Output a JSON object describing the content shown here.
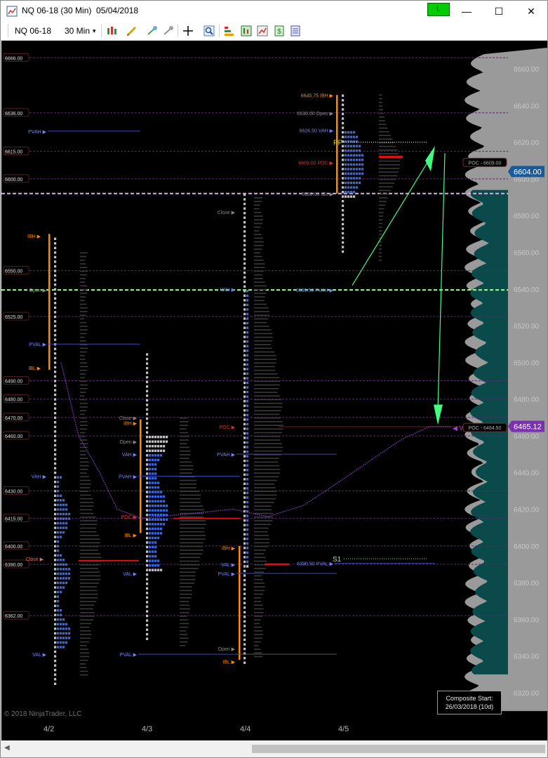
{
  "window": {
    "title": "NQ 06-18 (30 Min)  05/04/2018",
    "status_badge": "L",
    "minimize_glyph": "—",
    "maximize_glyph": "☐",
    "close_glyph": "✕"
  },
  "toolbar": {
    "instrument": "NQ 06-18",
    "interval": "30 Min",
    "dropdown_glyph": "▾",
    "icons": [
      "bar-type-icon",
      "drawing-tool-icon",
      "indicators-icon",
      "strategies-icon",
      "crosshair-icon",
      "zoom-icon",
      "chart-trader-icon",
      "data-box-icon",
      "chart-style-icon",
      "properties-icon",
      "templates-icon"
    ]
  },
  "price_axis": {
    "ticks": [
      "6660.00",
      "6640.00",
      "6620.00",
      "6600.00",
      "6580.00",
      "6560.00",
      "6540.00",
      "6520.00",
      "6500.00",
      "6480.00",
      "6460.00",
      "6440.00",
      "6420.00",
      "6400.00",
      "6380.00",
      "6360.00",
      "6340.00",
      "6320.00"
    ],
    "current_price": "6604.00",
    "composite_poc_label": "POC - 6609.00",
    "vwap_price": "6465.12",
    "vwap_poc_label": "POC - 6464.50"
  },
  "left_price_labels": [
    "6666.00",
    "6636.00",
    "6615.00",
    "6600.00",
    "6550.00",
    "6525.00",
    "6490.00",
    "6480.00",
    "6470.00",
    "6460.00",
    "6430.00",
    "6415.00",
    "6400.00",
    "6390.00",
    "6362.00"
  ],
  "sessions": [
    {
      "date": "4/2",
      "labels": [
        "IBH",
        "Open",
        "PVAH",
        "PVAL",
        "IBL",
        "VAH",
        "Close",
        "VAL"
      ]
    },
    {
      "date": "4/3",
      "labels": [
        "Close",
        "IBH",
        "Open",
        "VAH",
        "PVAH",
        "POC",
        "IBL",
        "VAL",
        "PVAL"
      ]
    },
    {
      "date": "4/4",
      "labels": [
        "Close",
        "VAH",
        "POC",
        "PVAH",
        "IBH",
        "VAL",
        "PVAL",
        "Open",
        "IBL"
      ]
    },
    {
      "date": "4/5",
      "labels": [
        "6645.75 IBH",
        "6636.00 Open",
        "6626.50 VAH",
        "6609.00 POC",
        "6592.00 IBL",
        "6539.50 PVAH",
        "6390.50 PVAL"
      ]
    }
  ],
  "pivots": {
    "pp": "PP",
    "s1": "S1",
    "vwap_marker": "V"
  },
  "x_axis": {
    "dates": [
      "4/2",
      "4/3",
      "4/4",
      "4/5"
    ]
  },
  "composite_box": {
    "line1": "Composite Start:",
    "line2": "26/03/2018 (10d)"
  },
  "copyright": "© 2018 NinjaTrader, LLC",
  "colors": {
    "profile_value_area": "#3a68d8",
    "profile_tpo": "#c0c0c0",
    "ib_bar": "#ff8c00",
    "poc": "#e01010",
    "vwap": "#a040e0",
    "pivot_line": "#90ee90",
    "arrow": "#40ff80",
    "composite_teal": "#0a4a4a"
  }
}
